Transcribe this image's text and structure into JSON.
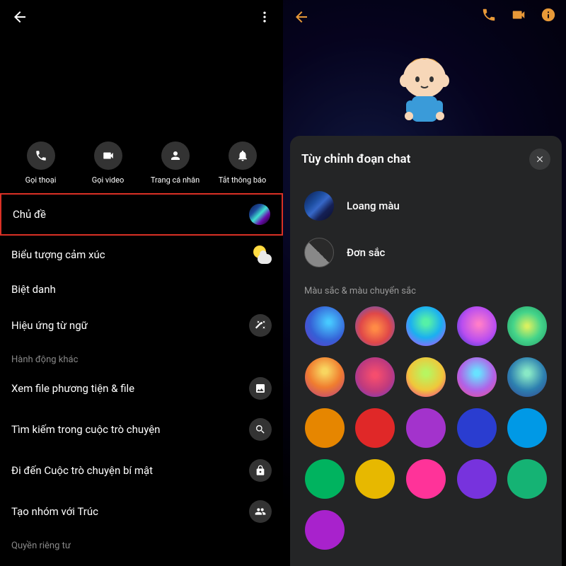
{
  "left": {
    "actions": [
      {
        "label": "Gọi thoại",
        "icon": "phone-icon"
      },
      {
        "label": "Gọi video",
        "icon": "video-icon"
      },
      {
        "label": "Trang cá nhân",
        "icon": "person-icon"
      },
      {
        "label": "Tắt thông báo",
        "icon": "bell-icon"
      }
    ],
    "items": {
      "theme": "Chủ đề",
      "emoji": "Biểu tượng cảm xúc",
      "nickname": "Biệt danh",
      "word_effects": "Hiệu ứng từ ngữ"
    },
    "section_other": "Hành động khác",
    "other": {
      "media": "Xem file phương tiện & file",
      "search": "Tìm kiếm trong cuộc trò chuyện",
      "secret": "Đi đến Cuộc trò chuyện bí mật",
      "group": "Tạo nhóm với Trúc"
    },
    "section_privacy": "Quyền riêng tư"
  },
  "right": {
    "modal_title": "Tùy chỉnh đoạn chat",
    "loang": "Loang màu",
    "don": "Đơn sắc",
    "color_section": "Màu sắc & màu chuyển sắc",
    "colors": [
      "radial-gradient(circle at 60% 40%, #47c9ff 5%, #3560d6 55%, #6638c6 100%)",
      "radial-gradient(circle at 50% 55%, #ff8a46 8%, #e04848 50%, #4a55d6 100%)",
      "radial-gradient(circle at 50% 40%, #55f0a8 10%, #1bb0f0 50%, #cc44ff 100%)",
      "radial-gradient(circle at 55% 45%, #ff7dc9 5%, #b94df0 55%, #2b38c7 100%)",
      "radial-gradient(circle at 50% 50%, #d8f060 5%, #44d48a 50%, #229966 100%)",
      "radial-gradient(circle at 50% 35%, #f8d560 8%, #f07d2f 50%, #b53d85 100%)",
      "radial-gradient(circle at 50% 45%, #f54d6e 8%, #c03a7d 55%, #6c3acc 100%)",
      "radial-gradient(circle at 50% 40%, #b8f560 8%, #f0c73a 55%, #f028a0 100%)",
      "radial-gradient(circle at 50% 40%, #68e2ff 8%, #b063e8 55%, #f04a88 100%)",
      "radial-gradient(circle at 50% 40%, #88e8c6 8%, #2d80b0 55%, #34418a 100%)",
      "#e68600",
      "#e02828",
      "#a333cc",
      "#2a3dd0",
      "#0099e6",
      "#00b35f",
      "#e7b800",
      "#ff3399",
      "#7733dd",
      "#15b374",
      "#a822cc"
    ]
  }
}
